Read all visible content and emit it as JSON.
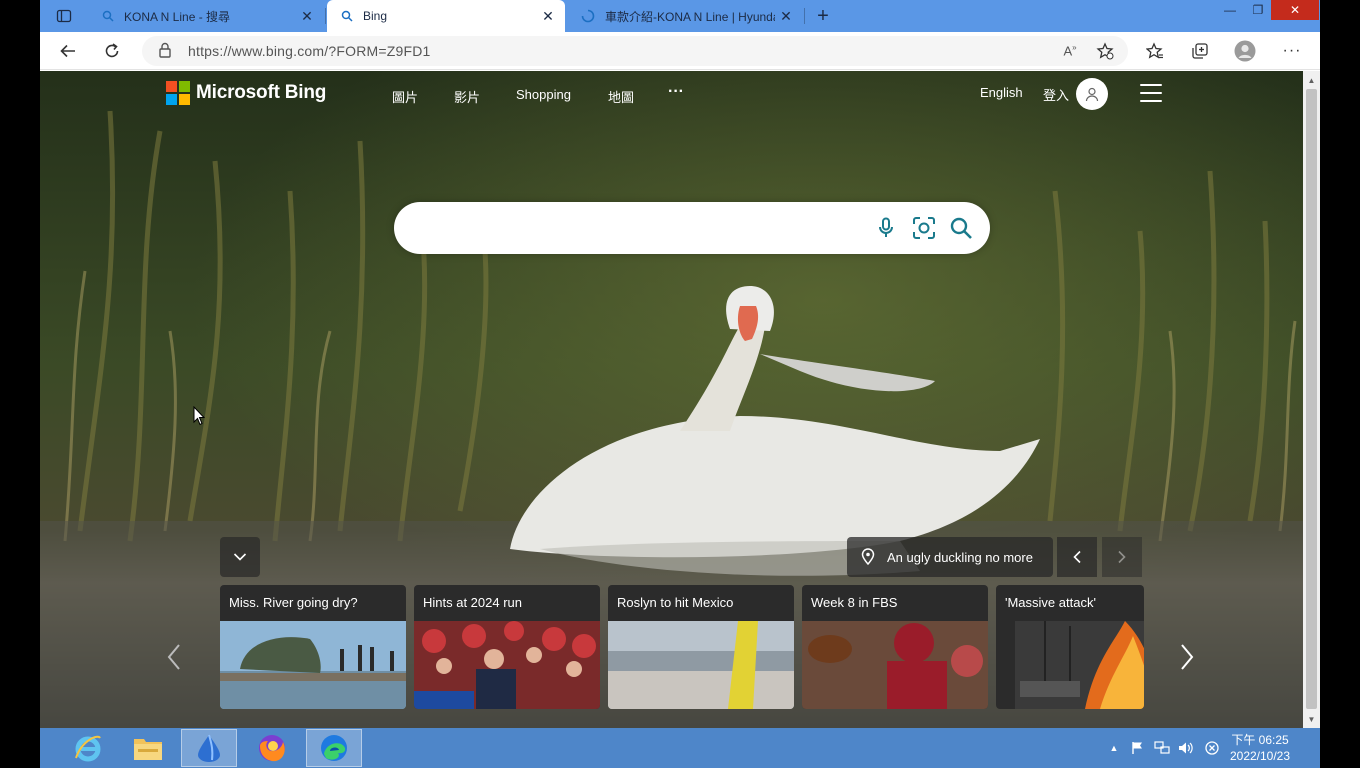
{
  "browser": {
    "tabs": [
      {
        "title": "KONA N Line - 搜尋",
        "icon": "search-icon",
        "active": false
      },
      {
        "title": "Bing",
        "icon": "search-icon",
        "active": true
      },
      {
        "title": "車款介紹-KONA N Line | Hyundai",
        "icon": "loading-icon",
        "active": false
      }
    ],
    "url": "https://www.bing.com/?FORM=Z9FD1"
  },
  "bing": {
    "logo_text": "Microsoft Bing",
    "nav": [
      "圖片",
      "影片",
      "Shopping",
      "地圖",
      "···"
    ],
    "language": "English",
    "signin": "登入",
    "search_placeholder": "",
    "image_caption": "An ugly duckling no more",
    "cards": [
      {
        "title": "Miss. River going dry?"
      },
      {
        "title": "Hints at 2024 run"
      },
      {
        "title": "Roslyn to hit Mexico"
      },
      {
        "title": "Week 8 in FBS"
      },
      {
        "title": "'Massive attack'"
      }
    ]
  },
  "taskbar": {
    "apps": [
      "internet-explorer-icon",
      "file-explorer-icon",
      "app-icon",
      "firefox-icon",
      "edge-icon"
    ],
    "time": "下午 06:25",
    "date": "2022/10/23"
  },
  "colors": {
    "titlebar": "#5a97e6",
    "taskbar": "#4e86c9",
    "bing_teal": "#1a7a8c",
    "close_red": "#c42b1c"
  }
}
